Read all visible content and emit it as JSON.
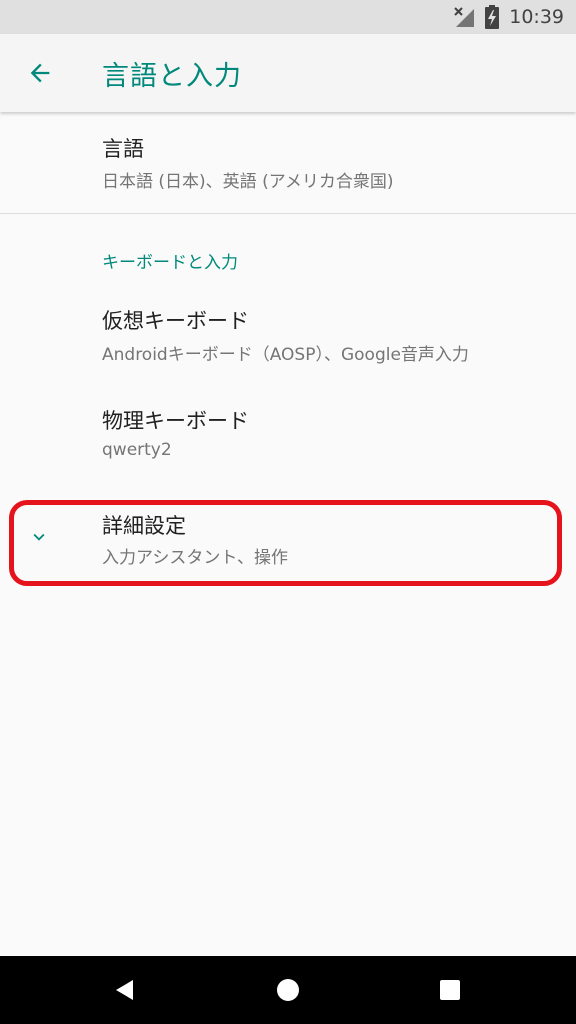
{
  "status_bar": {
    "time": "10:39",
    "icons": [
      "no-signal-icon",
      "battery-charging-icon"
    ]
  },
  "app_bar": {
    "title": "言語と入力",
    "back_icon": "arrow-back-icon"
  },
  "preferences": {
    "language": {
      "title": "言語",
      "summary": "日本語 (日本)、英語 (アメリカ合衆国)"
    },
    "category_keyboard": "キーボードと入力",
    "virtual_keyboard": {
      "title": "仮想キーボード",
      "summary": "Androidキーボード（AOSP）、Google音声入力"
    },
    "physical_keyboard": {
      "title": "物理キーボード",
      "summary": "qwerty2"
    },
    "advanced": {
      "title": "詳細設定",
      "summary": "入力アシスタント、操作",
      "icon": "chevron-down-icon"
    }
  },
  "colors": {
    "accent": "#00897b",
    "highlight": "#e5131c"
  },
  "nav_bar": {
    "icons": [
      "back-triangle-icon",
      "home-circle-icon",
      "recents-square-icon"
    ]
  }
}
